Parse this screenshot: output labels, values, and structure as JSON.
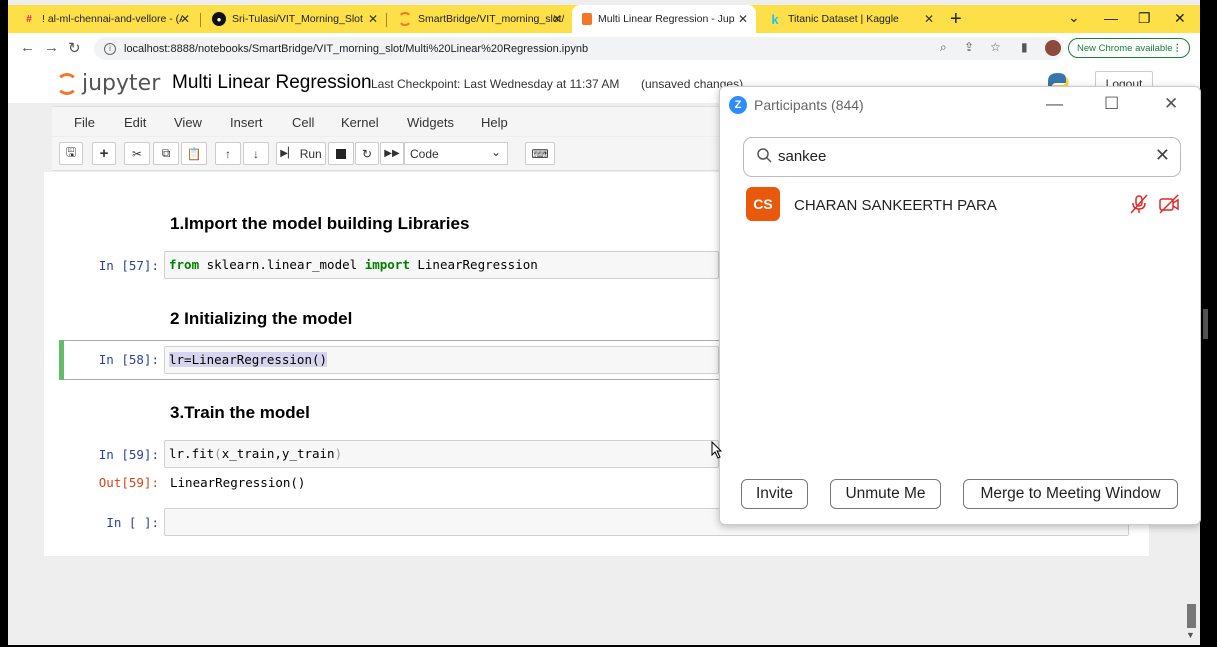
{
  "browser": {
    "tabs": [
      {
        "title": "! al-ml-chennai-and-vellore - (AF",
        "favicon": "slack-icon"
      },
      {
        "title": "Sri-Tulasi/VIT_Morning_Slot",
        "favicon": "github-icon"
      },
      {
        "title": "SmartBridge/VIT_morning_slot/",
        "favicon": "jupyter-icon"
      },
      {
        "title": "Multi Linear Regression - Jupyter",
        "favicon": "jupyter-icon",
        "active": true
      },
      {
        "title": "Titanic Dataset | Kaggle",
        "favicon": "kaggle-icon"
      }
    ],
    "url": "localhost:8888/notebooks/SmartBridge/VIT_morning_slot/Multi%20Linear%20Regression.ipynb",
    "new_chrome_label": "New Chrome available",
    "tab_bar_color": "#fde047"
  },
  "jupyter": {
    "logo_text": "jupyter",
    "notebook_title": "Multi Linear Regression",
    "checkpoint": "Last Checkpoint: Last Wednesday at 11:37 AM",
    "unsaved": "(unsaved changes)",
    "logout_label": "Logout",
    "menu": [
      "File",
      "Edit",
      "View",
      "Insert",
      "Cell",
      "Kernel",
      "Widgets",
      "Help"
    ],
    "run_label": "Run",
    "cell_type": "Code"
  },
  "notebook": {
    "heading1": "1.Import the model building Libraries",
    "cell57_prompt": "In [57]:",
    "cell57_kw_from": "from",
    "cell57_module": " sklearn.linear_model ",
    "cell57_kw_import": "import",
    "cell57_name": " LinearRegression",
    "heading2": "2 Initializing the model",
    "cell58_prompt": "In [58]:",
    "cell58_code": "lr=LinearRegression()",
    "heading3": "3.Train the model",
    "cell59_prompt": "In [59]:",
    "cell59_code_a": "lr.fit",
    "cell59_code_b": "(",
    "cell59_code_c": "x_train,y_train",
    "cell59_code_d": ")",
    "out59_prompt": "Out[59]:",
    "out59_text": "LinearRegression()",
    "empty_prompt": "In [ ]:"
  },
  "zoom": {
    "title": "Participants (844)",
    "search_value": "sankee",
    "participant": {
      "initials": "CS",
      "name": "CHARAN SANKEERTH PARA",
      "avatar_color": "#e8590c"
    },
    "buttons": {
      "invite": "Invite",
      "unmute": "Unmute Me",
      "merge": "Merge to Meeting Window"
    }
  }
}
